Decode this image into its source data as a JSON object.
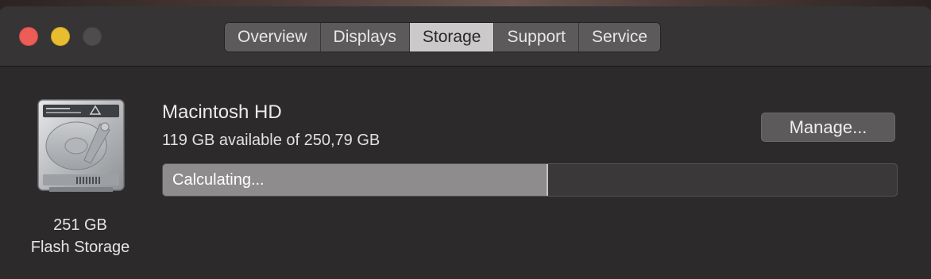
{
  "window": {
    "tabs": [
      {
        "label": "Overview",
        "active": false
      },
      {
        "label": "Displays",
        "active": false
      },
      {
        "label": "Storage",
        "active": true
      },
      {
        "label": "Support",
        "active": false
      },
      {
        "label": "Service",
        "active": false
      }
    ]
  },
  "disk": {
    "icon": "hard-drive-icon",
    "capacity_label": "251 GB",
    "type_label": "Flash Storage"
  },
  "volume": {
    "name": "Macintosh HD",
    "availability": "119 GB available of 250,79 GB",
    "manage_label": "Manage...",
    "bar_status": "Calculating...",
    "used_fraction": 0.525
  },
  "colors": {
    "close": "#ed5d58",
    "minimize": "#e8bd2f",
    "zoom": "#4f4c4d",
    "active_tab": "#cbc9ca"
  }
}
